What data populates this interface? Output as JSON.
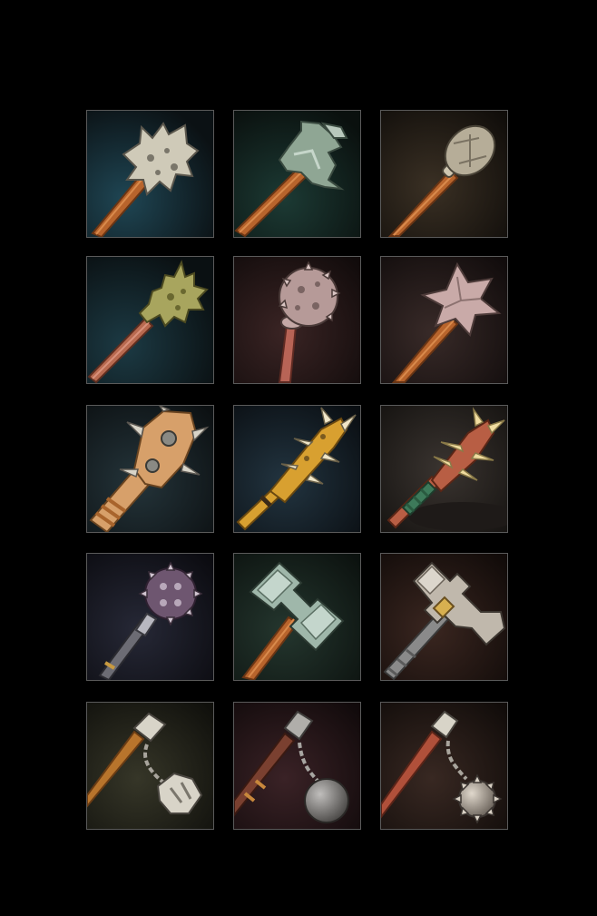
{
  "inventory": {
    "rows": 5,
    "columns": 3,
    "slots": [
      {
        "icon": "spiked-stone-mace-icon",
        "background": "#1a3a48",
        "handle": "#b8642c",
        "head": "#cfcab8"
      },
      {
        "icon": "flanged-iron-mace-icon",
        "background": "#16302c",
        "handle": "#b8642c",
        "head": "#8fa694"
      },
      {
        "icon": "ribbed-steel-mace-icon",
        "background": "#2a241c",
        "handle": "#b8642c",
        "head": "#b6ad98"
      },
      {
        "icon": "spiked-bronze-mace-icon",
        "background": "#17303a",
        "handle": "#b86a50",
        "head": "#a8a55e"
      },
      {
        "icon": "studded-morning-star-icon",
        "background": "#2c1c1c",
        "handle": "#b86456",
        "head": "#b69a98"
      },
      {
        "icon": "star-head-mace-icon",
        "background": "#2c2020",
        "handle": "#b8642c",
        "head": "#c9aaa8"
      },
      {
        "icon": "spiked-wooden-club-icon",
        "background": "#1e2c30",
        "handle": "#d7a06a",
        "head": "#d7a06a"
      },
      {
        "icon": "bone-spiked-club-icon",
        "background": "#1a2630",
        "handle": "#d8a030",
        "head": "#d8a030"
      },
      {
        "icon": "thorned-crimson-club-icon",
        "background": "#2c2824",
        "handle": "#3d7a5a",
        "head": "#b85e44"
      },
      {
        "icon": "purple-spiked-flail-mace-icon",
        "background": "#1e2030",
        "handle": "#6c6c74",
        "head": "#6e5670"
      },
      {
        "icon": "jade-war-hammer-icon",
        "background": "#1c2a24",
        "handle": "#b8642c",
        "head": "#9fb7aa"
      },
      {
        "icon": "gold-banded-war-hammer-icon",
        "background": "#2c1c18",
        "handle": "#8a8a8a",
        "head": "#c0b8ac"
      },
      {
        "icon": "claw-head-flail-icon",
        "background": "#262820",
        "handle": "#b8742c",
        "head": "#d8d4c8"
      },
      {
        "icon": "ball-and-chain-flail-icon",
        "background": "#2c1a1c",
        "handle": "#7a4030",
        "head": "#8c8a88"
      },
      {
        "icon": "spiked-ball-flail-icon",
        "background": "#2a1c18",
        "handle": "#b0503a",
        "head": "#b8aca0"
      }
    ]
  }
}
